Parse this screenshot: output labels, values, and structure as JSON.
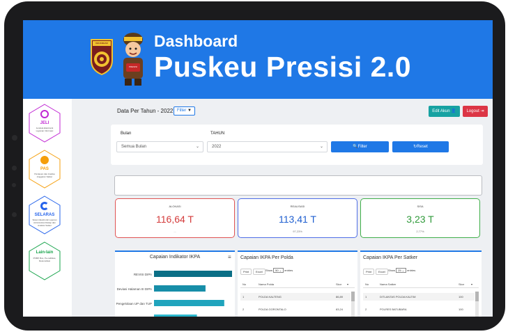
{
  "header": {
    "title_line1": "Dashboard",
    "title_line2": "Puskeu Presisi 2.0",
    "logo_text": "KEUANGAN",
    "mascot_text": "PRESISI",
    "bg_color": "#1f78e6"
  },
  "sidebar": {
    "items": [
      {
        "label": "JELI",
        "sub": "Jendela Elektronik Layanan Informasi",
        "color": "#c026d3",
        "icon": "jeli-icon"
      },
      {
        "label": "PAS",
        "sub": "Pantauan dan Analisa Anggaran Satker",
        "color": "#f59e0b",
        "icon": "pas-icon"
      },
      {
        "label": "SELARAS",
        "sub": "Sistem Elektronik Laporan Administrasi Rekap dan Analisis Satker",
        "color": "#2563eb",
        "icon": "selaras-icon"
      },
      {
        "label": "Lain-lain",
        "sub": "PNBP, Bos, Pe-nalitikas, Rekonsiliasi",
        "color": "#16a34a",
        "icon": "lainlain-icon"
      }
    ]
  },
  "toolbar": {
    "data_label": "Data Per Tahun - 2022",
    "filter_label": "Filter",
    "edit_label": "Edit Akun",
    "logout_label": "Logout"
  },
  "filter": {
    "bulan_label": "Bulan",
    "bulan_value": "Semua Bulan",
    "tahun_label": "TAHUN",
    "tahun_value": "2022",
    "filter_btn": "Filter",
    "reset_btn": "Reset"
  },
  "stats": [
    {
      "label": "ALOKASI",
      "value": "116,64 T",
      "pct": "...",
      "color": "#e05353"
    },
    {
      "label": "REALISASI",
      "value": "113,41 T",
      "pct": "97,23%",
      "color": "#4f6de6"
    },
    {
      "label": "SISA",
      "value": "3,23 T",
      "pct": "2,77%",
      "color": "#3fae49"
    }
  ],
  "ikpa_chart": {
    "title": "Capaian Indikator IKPA",
    "menu_icon": "hamburger-icon"
  },
  "chart_data": {
    "type": "bar",
    "orientation": "horizontal",
    "title": "Capaian Indikator IKPA",
    "categories": [
      "REVISI DIPA",
      "Deviasi Halaman III DIPA",
      "Pengelolaan UP dan TUP",
      ""
    ],
    "values": [
      100,
      66,
      90,
      55
    ],
    "colors": [
      "#0b6f86",
      "#178ea8",
      "#20a4bd",
      "#2bb6cc"
    ]
  },
  "polda_table": {
    "title": "Capaian IKPA Per Polda",
    "print": "Print",
    "excel": "Excel",
    "show": "Show",
    "entries_value": "50",
    "entries": "entries",
    "columns": [
      "No",
      "Nama Polda",
      "Skor"
    ],
    "rows": [
      [
        "1",
        "POLDA KALTENG",
        "86,89"
      ],
      [
        "2",
        "POLDA GORONTALO",
        "83,24"
      ]
    ]
  },
  "satker_table": {
    "title": "Capaian IKPA Per Satker",
    "print": "Print",
    "excel": "Excel",
    "show": "Show",
    "entries_value": "25",
    "entries": "entries",
    "columns": [
      "No",
      "Nama Satker",
      "Skor"
    ],
    "rows": [
      [
        "1",
        "DITLANTAS POLDA KALTIM",
        "100"
      ],
      [
        "2",
        "POLRES BATUBARA",
        "100"
      ]
    ]
  }
}
